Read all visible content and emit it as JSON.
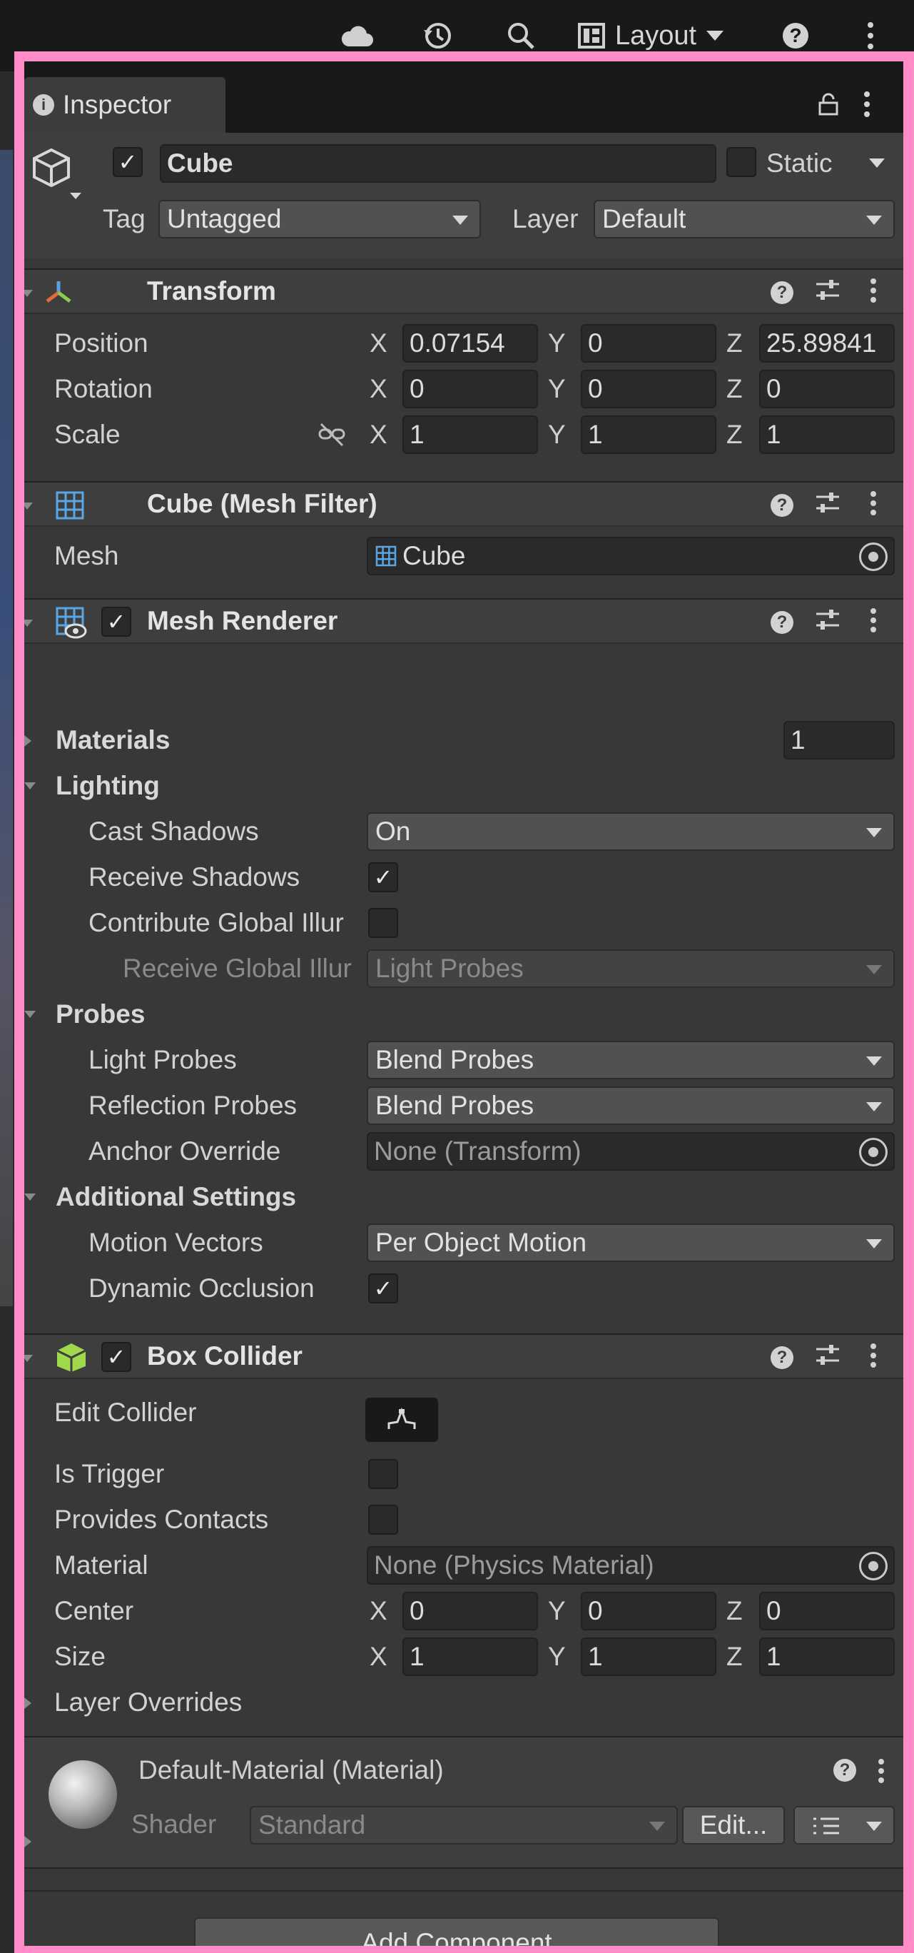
{
  "toolbar": {
    "layout_label": "Layout",
    "icons": [
      "cloud-icon",
      "history-icon",
      "search-icon",
      "layout-icon",
      "help-icon",
      "more-icon"
    ]
  },
  "inspector": {
    "tab_title": "Inspector",
    "object": {
      "name": "Cube",
      "active": true,
      "static_label": "Static",
      "tag_label": "Tag",
      "tag_value": "Untagged",
      "layer_label": "Layer",
      "layer_value": "Default"
    },
    "transform": {
      "title": "Transform",
      "position_label": "Position",
      "rotation_label": "Rotation",
      "scale_label": "Scale",
      "position": {
        "x": "0.07154",
        "y": "0",
        "z": "25.89841"
      },
      "rotation": {
        "x": "0",
        "y": "0",
        "z": "0"
      },
      "scale": {
        "x": "1",
        "y": "1",
        "z": "1"
      },
      "axis_x": "X",
      "axis_y": "Y",
      "axis_z": "Z"
    },
    "mesh_filter": {
      "title": "Cube (Mesh Filter)",
      "mesh_label": "Mesh",
      "mesh_value": "Cube"
    },
    "mesh_renderer": {
      "title": "Mesh Renderer",
      "materials_label": "Materials",
      "materials_count": "1",
      "lighting_label": "Lighting",
      "cast_shadows_label": "Cast Shadows",
      "cast_shadows_value": "On",
      "receive_shadows_label": "Receive Shadows",
      "contribute_gi_label": "Contribute Global Illur",
      "receive_gi_label": "Receive Global Illur",
      "receive_gi_value": "Light Probes",
      "probes_label": "Probes",
      "light_probes_label": "Light Probes",
      "light_probes_value": "Blend Probes",
      "reflection_probes_label": "Reflection Probes",
      "reflection_probes_value": "Blend Probes",
      "anchor_override_label": "Anchor Override",
      "anchor_override_value": "None (Transform)",
      "additional_label": "Additional Settings",
      "motion_vectors_label": "Motion Vectors",
      "motion_vectors_value": "Per Object Motion",
      "dynamic_occlusion_label": "Dynamic Occlusion"
    },
    "box_collider": {
      "title": "Box Collider",
      "edit_collider_label": "Edit Collider",
      "is_trigger_label": "Is Trigger",
      "provides_contacts_label": "Provides Contacts",
      "material_label": "Material",
      "material_value": "None (Physics Material)",
      "center_label": "Center",
      "size_label": "Size",
      "center": {
        "x": "0",
        "y": "0",
        "z": "0"
      },
      "size": {
        "x": "1",
        "y": "1",
        "z": "1"
      },
      "layer_overrides_label": "Layer Overrides"
    },
    "material": {
      "title": "Default-Material (Material)",
      "shader_label": "Shader",
      "shader_value": "Standard",
      "edit_label": "Edit..."
    },
    "add_component_label": "Add Component"
  },
  "colors": {
    "frame": "#ff8cc6",
    "panel_bg": "#383838",
    "header_bg": "#3e3e3e",
    "field_bg": "#2a2a2a",
    "box_collider_icon": "#9fd84a"
  }
}
